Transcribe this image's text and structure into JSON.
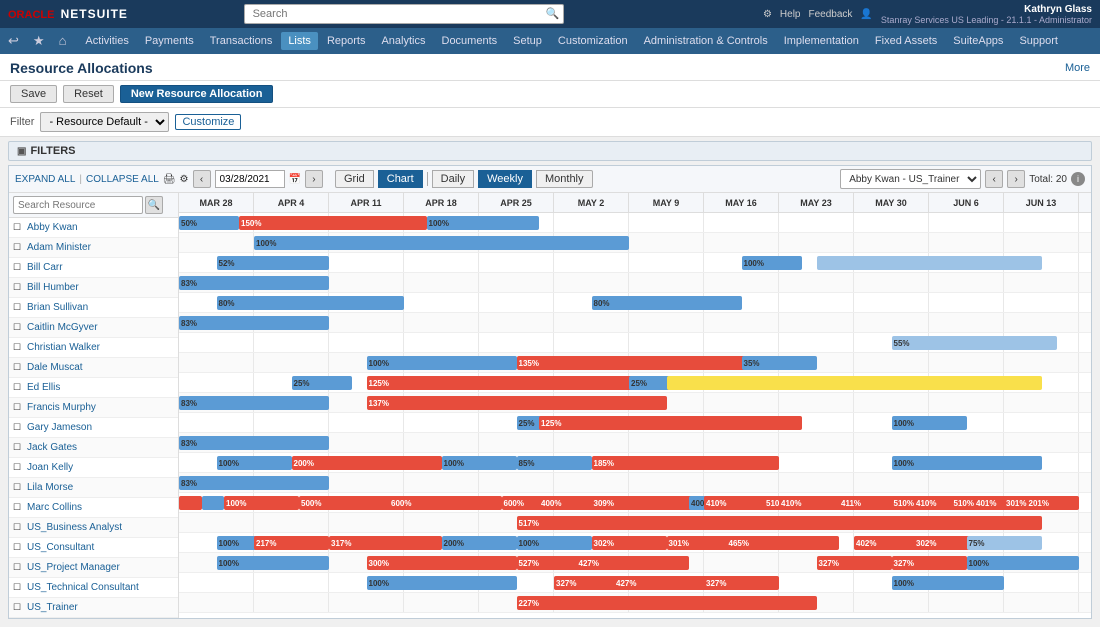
{
  "app": {
    "logo_oracle": "ORACLE",
    "logo_netsuite": "NETSUITE",
    "search_placeholder": "Search"
  },
  "top_right": {
    "settings_icon": "⚙",
    "help_label": "Help",
    "feedback_label": "Feedback",
    "user_name": "Kathryn Glass",
    "user_company": "Stanray Services US Leading",
    "user_role": "Administrator",
    "user_version": "21.1.1"
  },
  "menu": {
    "icons": [
      "↩",
      "★",
      "⌂"
    ],
    "items": [
      "Activities",
      "Payments",
      "Transactions",
      "Lists",
      "Reports",
      "Analytics",
      "Documents",
      "Setup",
      "Customization",
      "Administration & Controls",
      "Implementation",
      "Fixed Assets",
      "SuiteApps",
      "Support"
    ],
    "active": "Lists"
  },
  "page": {
    "title": "Resource Allocations",
    "more_label": "More"
  },
  "toolbar": {
    "save_label": "Save",
    "reset_label": "Reset",
    "new_label": "New Resource Allocation"
  },
  "filter": {
    "label": "Filter",
    "default_option": "- Resource Default -",
    "customize_label": "Customize"
  },
  "filters_section": {
    "label": "FILTERS"
  },
  "gantt": {
    "expand_all": "EXPAND ALL",
    "collapse_all": "COLLAPSE ALL",
    "date_value": "03/28/2021",
    "view_grid": "Grid",
    "view_chart": "Chart",
    "view_daily": "Daily",
    "view_weekly": "Weekly",
    "view_monthly": "Monthly",
    "active_view": "Chart",
    "active_period": "Weekly",
    "resource_dropdown": "Abby Kwan - US_Trainer",
    "nav_prev": "‹",
    "nav_next": "›",
    "total_label": "Total: 20",
    "search_placeholder": "Search Resource",
    "date_columns": [
      "MAR 28",
      "APR 4",
      "APR 11",
      "APR 18",
      "APR 25",
      "MAY 2",
      "MAY 9",
      "MAY 16",
      "MAY 23",
      "MAY 30",
      "JUN 6",
      "JUN 13"
    ],
    "resources": [
      {
        "name": "Abby Kwan",
        "bold": false
      },
      {
        "name": "Adam Minister",
        "bold": false
      },
      {
        "name": "Bill Carr",
        "bold": false
      },
      {
        "name": "Bill Humber",
        "bold": false
      },
      {
        "name": "Brian Sullivan",
        "bold": false
      },
      {
        "name": "Caitlin McGyver",
        "bold": false
      },
      {
        "name": "Christian Walker",
        "bold": false
      },
      {
        "name": "Dale Muscat",
        "bold": false
      },
      {
        "name": "Ed Ellis",
        "bold": false
      },
      {
        "name": "Francis Murphy",
        "bold": false
      },
      {
        "name": "Gary Jameson",
        "bold": false
      },
      {
        "name": "Jack Gates",
        "bold": false
      },
      {
        "name": "Joan Kelly",
        "bold": false
      },
      {
        "name": "Lila Morse",
        "bold": false
      },
      {
        "name": "Marc Collins",
        "bold": false
      },
      {
        "name": "US_Business Analyst",
        "bold": false
      },
      {
        "name": "US_Consultant",
        "bold": false
      },
      {
        "name": "US_Project Manager",
        "bold": false
      },
      {
        "name": "US_Technical Consultant",
        "bold": false
      },
      {
        "name": "US_Trainer",
        "bold": false
      }
    ]
  }
}
